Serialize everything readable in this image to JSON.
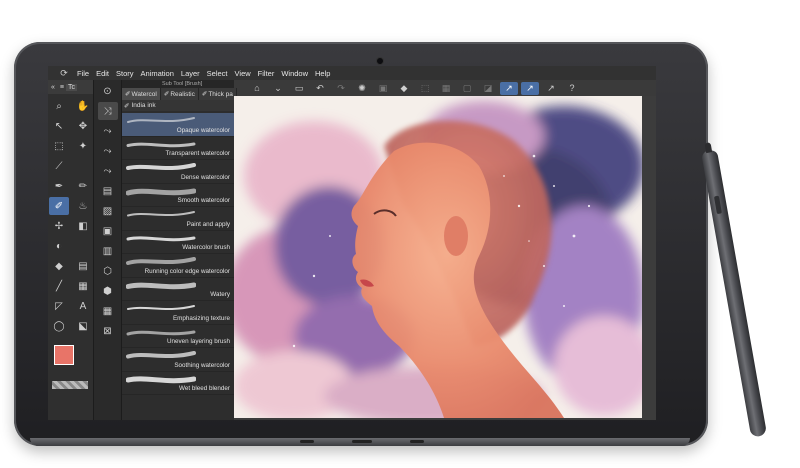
{
  "menu": {
    "items": [
      "File",
      "Edit",
      "Story",
      "Animation",
      "Layer",
      "Select",
      "View",
      "Filter",
      "Window",
      "Help"
    ]
  },
  "tool_panel": {
    "tab_label": "Tc",
    "main_color": "#e87468",
    "sub_color": "#ffffff"
  },
  "sub_tool_panel": {
    "title": "Sub Tool [Brush]",
    "tabs": [
      "Watercol",
      "Realistic",
      "Thick pa"
    ],
    "extra_tab": "India ink",
    "brushes": [
      "Opaque watercolor",
      "Transparent watercolor",
      "Dense watercolor",
      "Smooth watercolor",
      "Paint and apply",
      "Watercolor brush",
      "Running color edge watercolor",
      "Watery",
      "Emphasizing texture",
      "Uneven layering brush",
      "Soothing watercolor",
      "Wet bleed blender"
    ],
    "selected_brush": "Opaque watercolor"
  },
  "colors": {
    "accent": "#4a6fa5",
    "panel_bg": "#2d2d2d",
    "selected_row": "#4a5b78"
  }
}
